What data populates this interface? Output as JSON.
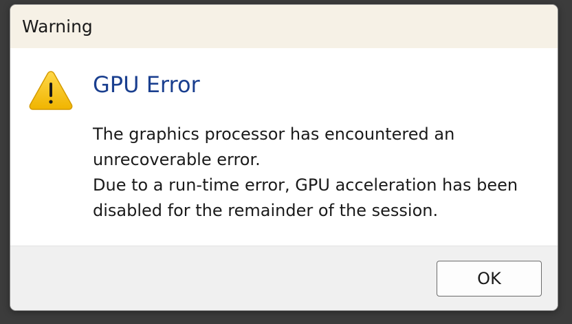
{
  "window": {
    "title": "Warning"
  },
  "dialog": {
    "icon": "warning-triangle-icon",
    "heading": "GPU Error",
    "message_lines": [
      "The graphics processor has encountered an",
      "unrecoverable error.",
      "Due to a run-time error, GPU acceleration has been",
      "disabled for the remainder of the session."
    ]
  },
  "buttons": {
    "ok_label": "OK"
  },
  "colors": {
    "titlebar_bg": "#f6f1e6",
    "heading": "#1a3f8f",
    "warning_fill": "#f5c316",
    "footer_bg": "#f0f0f0"
  }
}
